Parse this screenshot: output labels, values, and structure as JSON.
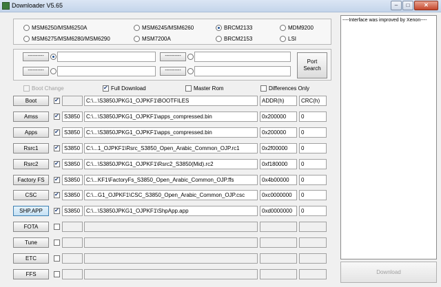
{
  "window": {
    "title": "Downloader V5.65",
    "minimize_glyph": "–",
    "maximize_glyph": "□",
    "close_glyph": "✕"
  },
  "models": [
    {
      "label": "MSM6250/MSM6250A",
      "selected": false
    },
    {
      "label": "MSM6245/MSM6260",
      "selected": false
    },
    {
      "label": "BRCM2133",
      "selected": true
    },
    {
      "label": "MDM9200",
      "selected": false
    },
    {
      "label": "MSM6275/MSM6280/MSM6290",
      "selected": false
    },
    {
      "label": "MSM7200A",
      "selected": false
    },
    {
      "label": "BRCM2153",
      "selected": false
    },
    {
      "label": "LSI",
      "selected": false
    }
  ],
  "ports": {
    "button_label": "----------",
    "port_search": "Port Search"
  },
  "options": {
    "boot_change": {
      "label": "Boot Change",
      "checked": false,
      "enabled": false
    },
    "full_download": {
      "label": "Full Download",
      "checked": true
    },
    "master_rom": {
      "label": "Master Rom",
      "checked": false
    },
    "differences_only": {
      "label": "Differences Only",
      "checked": false
    }
  },
  "headers": {
    "addr": "ADDR(h)",
    "crc": "CRC(h)"
  },
  "rows": [
    {
      "name": "Boot",
      "checked": true,
      "model": "",
      "path": "C:\\...\\S3850JPKG1_OJPKF1\\BOOTFILES",
      "addr": "ADDR(h)",
      "crc": "CRC(h)"
    },
    {
      "name": "Amss",
      "checked": true,
      "model": "S3850",
      "path": "C:\\...\\S3850JPKG1_OJPKF1\\apps_compressed.bin",
      "addr": "0x200000",
      "crc": "0"
    },
    {
      "name": "Apps",
      "checked": true,
      "model": "S3850",
      "path": "C:\\...\\S3850JPKG1_OJPKF1\\apps_compressed.bin",
      "addr": "0x200000",
      "crc": "0"
    },
    {
      "name": "Rsrc1",
      "checked": true,
      "model": "S3850",
      "path": "C:\\...1_OJPKF1\\Rsrc_S3850_Open_Arabic_Common_OJP.rc1",
      "addr": "0x2f00000",
      "crc": "0"
    },
    {
      "name": "Rsrc2",
      "checked": true,
      "model": "S3850",
      "path": "C:\\...\\S3850JPKG1_OJPKF1\\Rsrc2_S3850(Mid).rc2",
      "addr": "0xf180000",
      "crc": "0"
    },
    {
      "name": "Factory FS",
      "checked": true,
      "model": "S3850",
      "path": "C:\\...KF1\\FactoryFs_S3850_Open_Arabic_Common_OJP.ffs",
      "addr": "0x4b00000",
      "crc": "0"
    },
    {
      "name": "CSC",
      "checked": true,
      "model": "S3850",
      "path": "C:\\...G1_OJPKF1\\CSC_S3850_Open_Arabic_Common_OJP.csc",
      "addr": "0xc0000000",
      "crc": "0"
    },
    {
      "name": "SHP.APP",
      "checked": true,
      "model": "S3850",
      "path": "C:\\...\\S3850JPKG1_OJPKF1\\ShpApp.app",
      "addr": "0xd0000000",
      "crc": "0"
    },
    {
      "name": "FOTA",
      "checked": false,
      "model": "",
      "path": "",
      "addr": "",
      "crc": ""
    },
    {
      "name": "Tune",
      "checked": false,
      "model": "",
      "path": "",
      "addr": "",
      "crc": ""
    },
    {
      "name": "ETC",
      "checked": false,
      "model": "",
      "path": "",
      "addr": "",
      "crc": ""
    },
    {
      "name": "FFS",
      "checked": false,
      "model": "",
      "path": "",
      "addr": "",
      "crc": ""
    }
  ],
  "log": {
    "text": "----Interface was improved by Xenon----"
  },
  "download": {
    "label": "Download"
  }
}
